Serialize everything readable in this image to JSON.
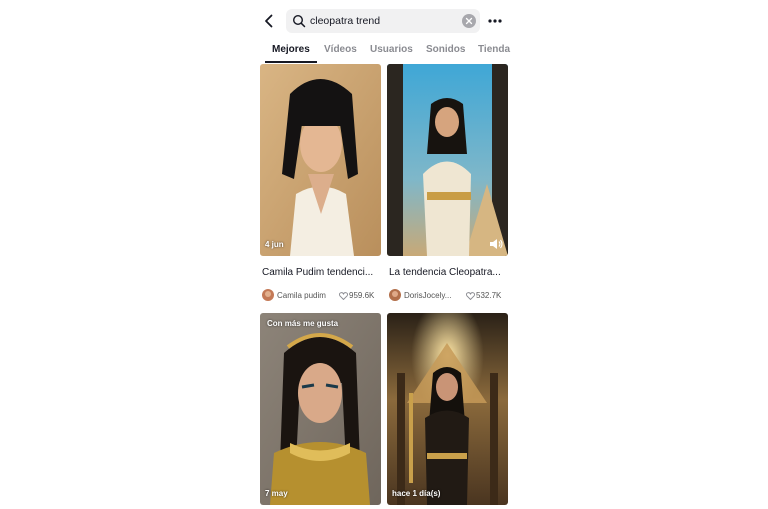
{
  "search": {
    "value": "cleopatra trend"
  },
  "tabs": [
    {
      "label": "Mejores",
      "active": true
    },
    {
      "label": "Vídeos"
    },
    {
      "label": "Usuarios"
    },
    {
      "label": "Sonidos"
    },
    {
      "label": "Tienda"
    }
  ],
  "results": [
    {
      "date": "4 jun",
      "caption": "Camila Pudim tendenci...",
      "user": "Camila pudim",
      "likes": "959.6K"
    },
    {
      "caption": "La tendencia Cleopatra...",
      "user": "DorisJocely...",
      "likes": "532.7K"
    },
    {
      "label": "Con más me gusta",
      "date": "7 may"
    },
    {
      "date": "hace 1 día(s)"
    }
  ],
  "icons": {
    "back": "chevron-left-icon",
    "search": "search-icon",
    "clear": "clear-icon",
    "more": "more-icon",
    "sound": "speaker-icon",
    "likes": "heart-icon"
  },
  "colors": {
    "text": "#161823",
    "muted": "#8a8b91",
    "search_bg": "#f1f1f2"
  }
}
